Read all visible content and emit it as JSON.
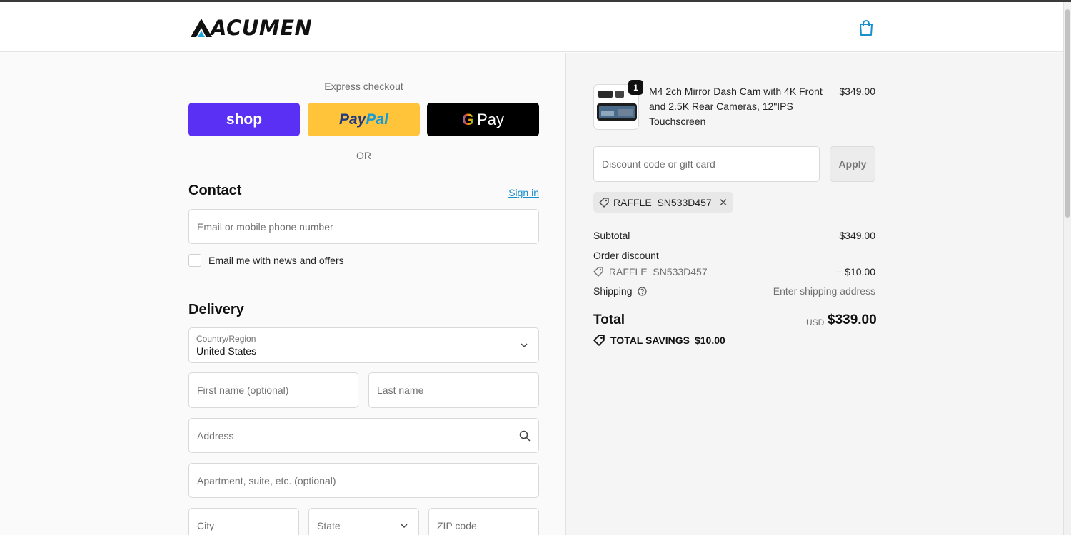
{
  "brand": {
    "logo_text": "ACUMEN"
  },
  "express": {
    "label": "Express checkout",
    "shop_label": "shop",
    "paypal_part1": "Pay",
    "paypal_part2": "Pal",
    "gpay_g": "G",
    "gpay_label": "Pay",
    "or_label": "OR"
  },
  "contact": {
    "title": "Contact",
    "signin_label": "Sign in",
    "email_placeholder": "Email or mobile phone number",
    "news_checkbox_label": "Email me with news and offers"
  },
  "delivery": {
    "title": "Delivery",
    "country_label": "Country/Region",
    "country_value": "United States",
    "first_name_placeholder": "First name (optional)",
    "last_name_placeholder": "Last name",
    "address_placeholder": "Address",
    "apartment_placeholder": "Apartment, suite, etc. (optional)",
    "city_placeholder": "City",
    "state_placeholder": "State",
    "zip_placeholder": "ZIP code"
  },
  "summary": {
    "product": {
      "quantity": "1",
      "name": "M4 2ch Mirror Dash Cam with 4K Front and 2.5K Rear Cameras, 12\"IPS Touchscreen",
      "price": "$349.00"
    },
    "discount_placeholder": "Discount code or gift card",
    "apply_label": "Apply",
    "applied_code": "RAFFLE_SN533D457",
    "subtotal_label": "Subtotal",
    "subtotal_value": "$349.00",
    "order_discount_label": "Order discount",
    "discount_code": "RAFFLE_SN533D457",
    "discount_value": "− $10.00",
    "shipping_label": "Shipping",
    "shipping_value": "Enter shipping address",
    "total_label": "Total",
    "total_currency": "USD",
    "total_value": "$339.00",
    "savings_label": "TOTAL SAVINGS",
    "savings_value": "$10.00"
  }
}
